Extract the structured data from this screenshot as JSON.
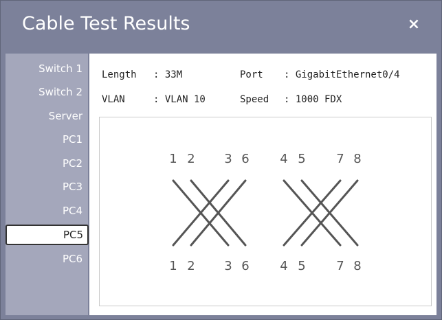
{
  "dialog": {
    "title": "Cable Test Results",
    "close_label": "×"
  },
  "sidebar": {
    "items": [
      {
        "label": "Switch 1"
      },
      {
        "label": "Switch 2"
      },
      {
        "label": "Server"
      },
      {
        "label": "PC1"
      },
      {
        "label": "PC2"
      },
      {
        "label": "PC3"
      },
      {
        "label": "PC4"
      },
      {
        "label": "PC5",
        "selected": true
      },
      {
        "label": "PC6"
      }
    ]
  },
  "info": {
    "length_label": "Length",
    "length_value": ": 33M",
    "port_label": "Port",
    "port_value": ": GigabitEthernet0/4",
    "vlan_label": "VLAN",
    "vlan_value": ": VLAN 10",
    "speed_label": "Speed",
    "speed_value": ": 1000 FDX"
  },
  "diagram": {
    "top_pins": [
      "1",
      "2",
      "3",
      "6",
      "4",
      "5",
      "7",
      "8"
    ],
    "bottom_pins": [
      "1",
      "2",
      "3",
      "6",
      "4",
      "5",
      "7",
      "8"
    ],
    "wiring": [
      [
        1,
        3
      ],
      [
        2,
        6
      ],
      [
        3,
        1
      ],
      [
        6,
        2
      ],
      [
        4,
        7
      ],
      [
        5,
        8
      ],
      [
        7,
        4
      ],
      [
        8,
        5
      ]
    ],
    "wire_color": "#555555"
  }
}
